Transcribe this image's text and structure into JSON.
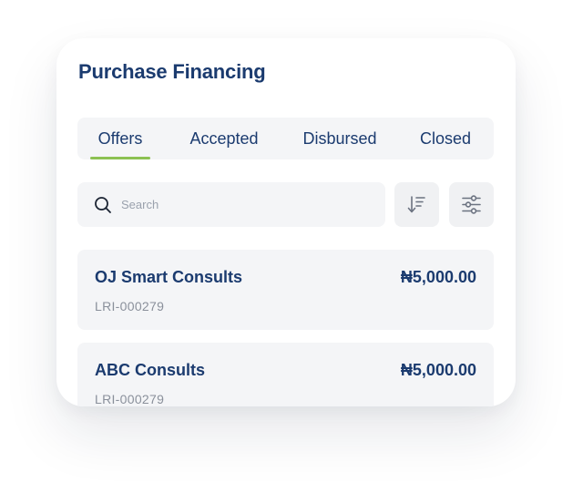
{
  "app": {
    "title": "Purchase Financing"
  },
  "tabs": [
    {
      "label": "Offers",
      "active": true
    },
    {
      "label": "Accepted",
      "active": false
    },
    {
      "label": "Disbursed",
      "active": false
    },
    {
      "label": "Closed",
      "active": false
    }
  ],
  "search": {
    "placeholder": "Search",
    "value": ""
  },
  "toolbar": {
    "sort_icon": "sort-icon",
    "filter_icon": "filter-sliders-icon"
  },
  "items": [
    {
      "name": "OJ Smart Consults",
      "amount": "₦5,000.00",
      "ref": "LRI-000279"
    },
    {
      "name": "ABC Consults",
      "amount": "₦5,000.00",
      "ref": "LRI-000279"
    }
  ],
  "colors": {
    "primary": "#1b3b6f",
    "accent": "#8cc152",
    "muted": "#8a909b",
    "surface": "#f4f5f7"
  }
}
